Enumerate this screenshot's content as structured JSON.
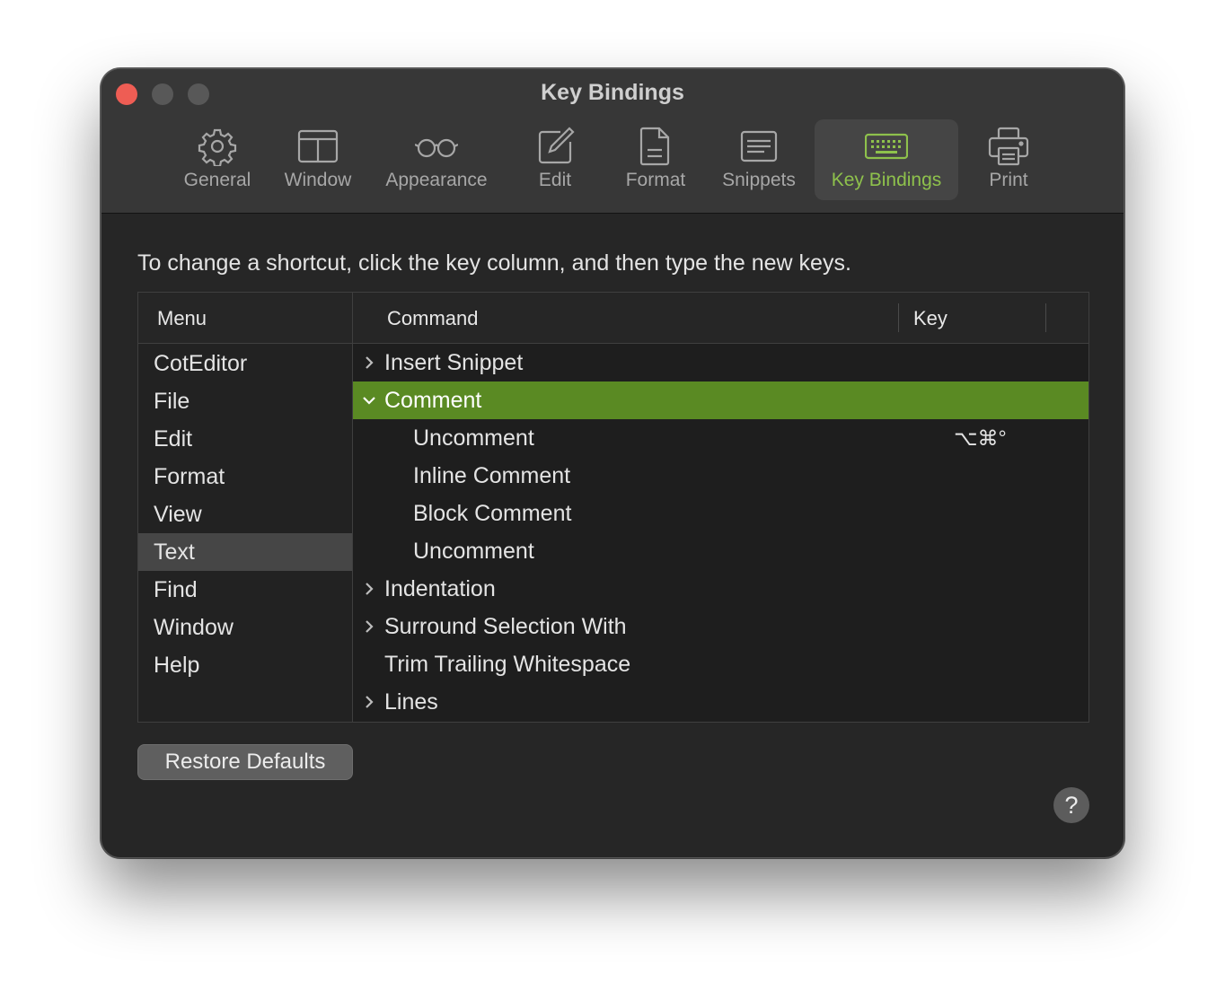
{
  "window": {
    "title": "Key Bindings"
  },
  "toolbar": {
    "items": [
      {
        "label": "General",
        "icon": "gear-icon"
      },
      {
        "label": "Window",
        "icon": "window-icon"
      },
      {
        "label": "Appearance",
        "icon": "glasses-icon"
      },
      {
        "label": "Edit",
        "icon": "pencil-square-icon"
      },
      {
        "label": "Format",
        "icon": "document-icon"
      },
      {
        "label": "Snippets",
        "icon": "snippets-icon"
      },
      {
        "label": "Key Bindings",
        "icon": "keyboard-icon",
        "active": true
      },
      {
        "label": "Print",
        "icon": "printer-icon"
      }
    ]
  },
  "main": {
    "instruction": "To change a shortcut, click the key column, and then type the new keys.",
    "columns": {
      "menu": "Menu",
      "command": "Command",
      "key": "Key"
    },
    "menus": [
      "CotEditor",
      "File",
      "Edit",
      "Format",
      "View",
      "Text",
      "Find",
      "Window",
      "Help"
    ],
    "selected_menu": "Text",
    "commands": [
      {
        "label": "Insert Snippet",
        "expandable": true,
        "expanded": false,
        "key": ""
      },
      {
        "label": "Comment",
        "expandable": true,
        "expanded": true,
        "selected": true,
        "key": ""
      },
      {
        "label": "Uncomment",
        "child": true,
        "key": "⌥⌘°"
      },
      {
        "label": "Inline Comment",
        "child": true,
        "key": ""
      },
      {
        "label": "Block Comment",
        "child": true,
        "key": ""
      },
      {
        "label": "Uncomment",
        "child": true,
        "key": ""
      },
      {
        "label": "Indentation",
        "expandable": true,
        "expanded": false,
        "key": ""
      },
      {
        "label": "Surround Selection With",
        "expandable": true,
        "expanded": false,
        "key": ""
      },
      {
        "label": "Trim Trailing Whitespace",
        "key": ""
      },
      {
        "label": "Lines",
        "expandable": true,
        "expanded": false,
        "key": ""
      }
    ],
    "restore_label": "Restore Defaults",
    "help_label": "?"
  },
  "colors": {
    "accent": "#8ec14c",
    "selection": "#5a8a23",
    "close": "#ee5d54"
  }
}
